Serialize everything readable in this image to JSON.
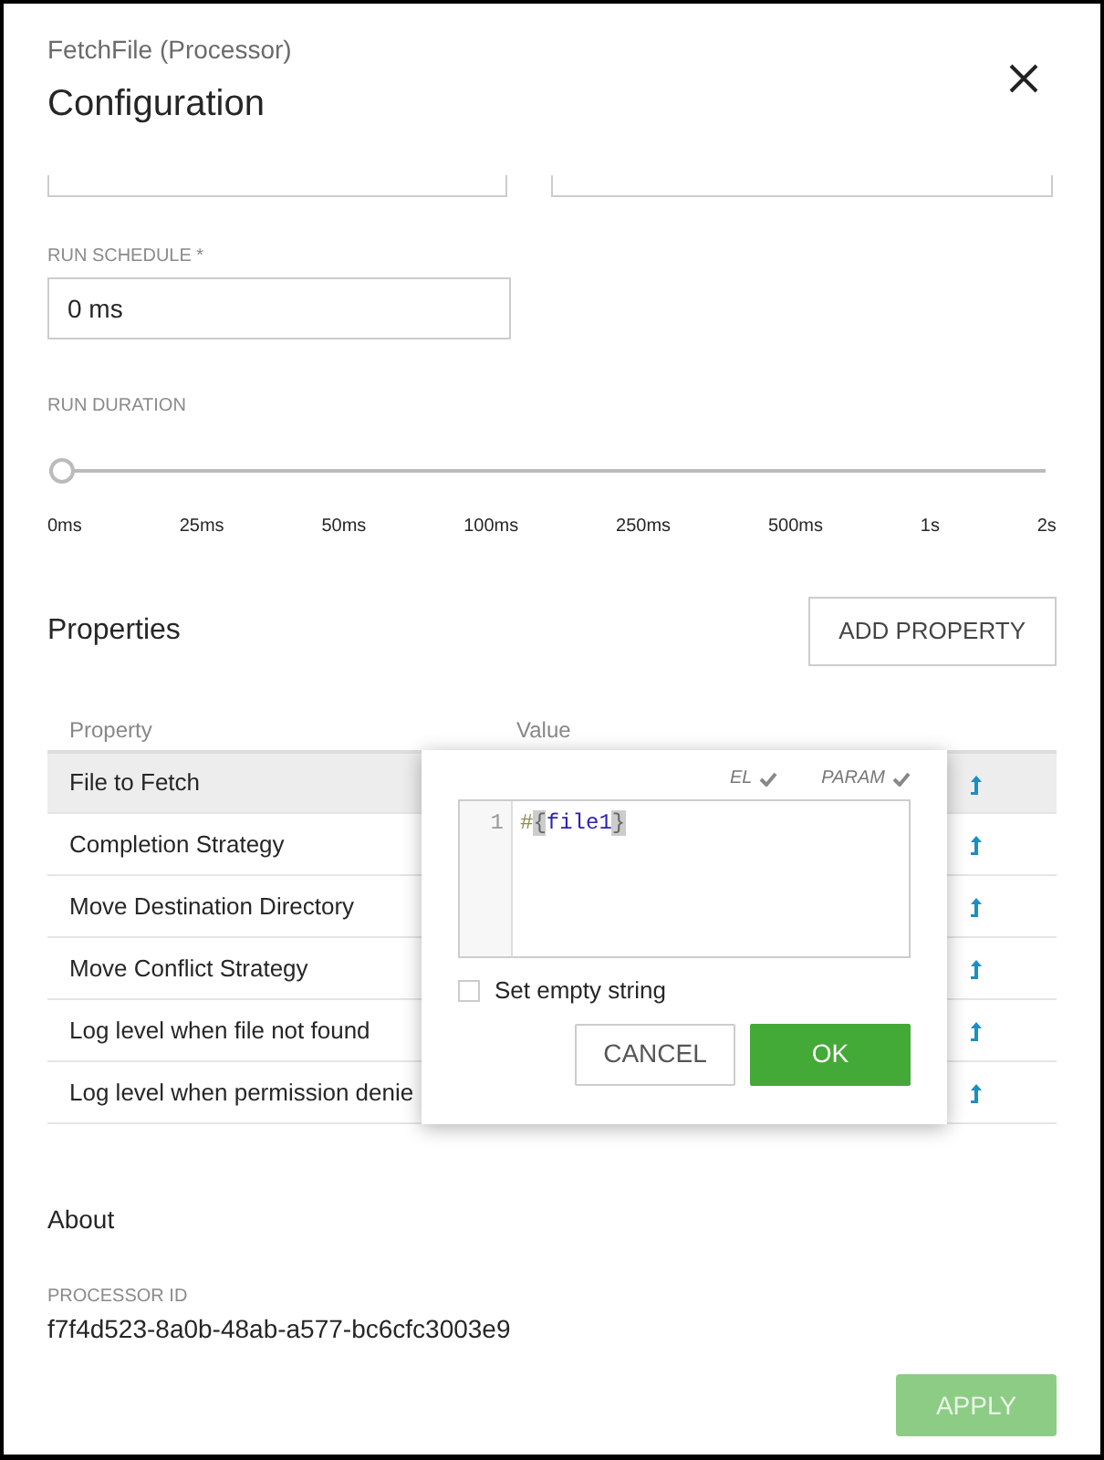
{
  "header": {
    "subtitle": "FetchFile (Processor)",
    "title": "Configuration"
  },
  "run_schedule": {
    "label": "RUN SCHEDULE *",
    "value": "0 ms"
  },
  "run_duration": {
    "label": "RUN DURATION",
    "level": 0,
    "ticks": [
      "0ms",
      "25ms",
      "50ms",
      "100ms",
      "250ms",
      "500ms",
      "1s",
      "2s"
    ]
  },
  "properties": {
    "title": "Properties",
    "add_button": "ADD PROPERTY",
    "columns": [
      "Property",
      "Value"
    ],
    "rows": [
      {
        "name": "File to Fetch",
        "selected": true
      },
      {
        "name": "Completion Strategy",
        "selected": false
      },
      {
        "name": "Move Destination Directory",
        "selected": false
      },
      {
        "name": "Move Conflict Strategy",
        "selected": false
      },
      {
        "name": "Log level when file not found",
        "selected": false
      },
      {
        "name": "Log level when permission denie",
        "selected": false
      }
    ]
  },
  "editor": {
    "flags": [
      {
        "label": "EL",
        "checked": true
      },
      {
        "label": "PARAM",
        "checked": true
      }
    ],
    "line_number": "1",
    "code": [
      {
        "text": "#",
        "kind": "operator"
      },
      {
        "text": "{",
        "kind": "bracket"
      },
      {
        "text": "file1",
        "kind": "variable"
      },
      {
        "text": "}",
        "kind": "bracket"
      }
    ],
    "empty_string": {
      "label": "Set empty string",
      "checked": false
    },
    "buttons": [
      {
        "label": "CANCEL",
        "kind": "secondary"
      },
      {
        "label": "OK",
        "kind": "primary"
      }
    ]
  },
  "about": {
    "title": "About",
    "id_label": "PROCESSOR ID",
    "id_value": "f7f4d523-8a0b-48ab-a577-bc6cfc3003e9"
  },
  "apply": {
    "label": "APPLY",
    "disabled": true
  }
}
